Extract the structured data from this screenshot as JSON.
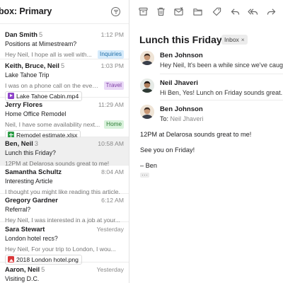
{
  "mailbox": {
    "title": "box: Primary"
  },
  "messages": [
    {
      "sender": "Dan Smith",
      "count": "5",
      "time": "1:12 PM",
      "subject": "Positions at Mimestream?",
      "preview": "Hey Neil, I hope all is well with...",
      "tag": "Inquiries",
      "tag_color": "blue"
    },
    {
      "sender": "Keith, Bruce, Neil",
      "count": "5",
      "time": "1:03 PM",
      "subject": "Lake Tahoe Trip",
      "preview": "I was on a phone call on the eveni...",
      "tag": "Travel",
      "tag_color": "purple",
      "attachment": "Lake Tahoe Cabin.mp4",
      "attachment_icon": "video-icon"
    },
    {
      "sender": "Jerry Flores",
      "count": "",
      "time": "11:29 AM",
      "subject": "Home Office Remodel",
      "preview": "Neil, I have some availability next...",
      "tag": "Home",
      "tag_color": "green",
      "attachment": "Remodel estimate.xlsx",
      "attachment_icon": "spreadsheet-icon"
    },
    {
      "sender": "Ben, Neil",
      "count": "3",
      "time": "10:58 AM",
      "subject": "Lunch this Friday?",
      "preview": "12PM at Delarosa sounds great to me!",
      "selected": true
    },
    {
      "sender": "Samantha Schultz",
      "count": "",
      "time": "8:04 AM",
      "subject": "Interesting Article",
      "preview": "I thought you might like reading this article."
    },
    {
      "sender": "Gregory Gardner",
      "count": "",
      "time": "6:12 AM",
      "subject": "Referral?",
      "preview": "Hey Neil, I was interested in a job at your..."
    },
    {
      "sender": "Sara Stewart",
      "count": "",
      "time": "Yesterday",
      "subject": "London hotel recs?",
      "preview": "Hey Neil, For your trip to London, I wou...",
      "attachment": "2018 London hotel.png",
      "attachment_icon": "image-icon"
    },
    {
      "sender": "Aaron, Neil",
      "count": "5",
      "time": "Yesterday",
      "subject": "Visiting D.C.",
      "preview": ""
    }
  ],
  "thread": {
    "title": "Lunch this Friday?",
    "label": "Inbox",
    "label_close": "×",
    "entries": [
      {
        "name": "Ben Johnson",
        "snippet": "Hey Neil, It's been a while since we've caught"
      },
      {
        "name": "Neil Jhaveri",
        "snippet": "Hi Ben, Yes! Lunch on Friday sounds great."
      },
      {
        "name": "Ben Johnson",
        "to_label": "To:",
        "to": "Neil Jhaveri"
      }
    ],
    "body": [
      "12PM at Delarosa sounds great to me!",
      "See you on Friday!",
      "– Ben"
    ]
  },
  "colors": {
    "tag_blue": "#d6ebfb",
    "tag_purple": "#ead9f7",
    "tag_green": "#d9f2dc",
    "selected_row": "#efefef"
  }
}
